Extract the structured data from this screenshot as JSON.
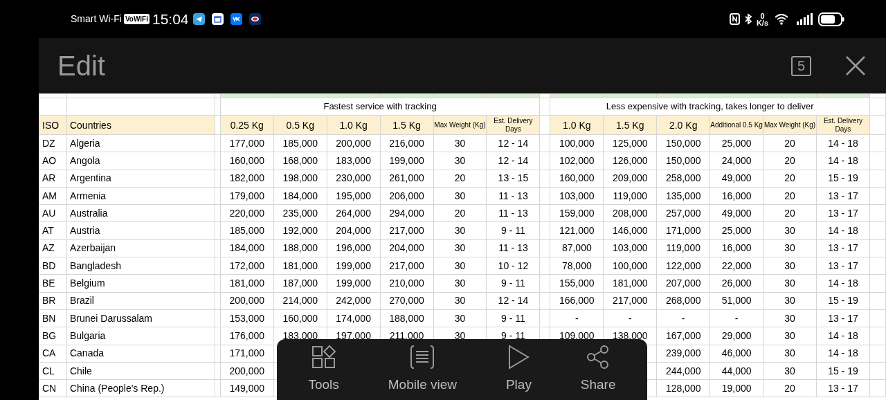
{
  "status_bar": {
    "carrier": "Smart Wi-Fi",
    "wifi_calling": "VoWiFi",
    "time": "15:04",
    "speed_value": "0",
    "speed_unit": "K/s"
  },
  "header": {
    "title": "Edit",
    "tab_count": "5"
  },
  "table": {
    "groups": [
      {
        "subtitle": "Fastest service with tracking"
      },
      {
        "subtitle": "Less expensive with tracking, takes longer to deliver"
      }
    ],
    "columns": [
      {
        "label": "ISO",
        "kind": "plain"
      },
      {
        "label": "Countries",
        "kind": "plain"
      },
      {
        "label": "0.25 Kg",
        "kind": "plain"
      },
      {
        "label": "0.5 Kg",
        "kind": "plain"
      },
      {
        "label": "1.0 Kg",
        "kind": "plain"
      },
      {
        "label": "1.5 Kg",
        "kind": "plain"
      },
      {
        "label": "Max Weight (Kg)",
        "kind": "note"
      },
      {
        "label": "Est. Delivery Days",
        "kind": "note"
      },
      {
        "label": "1.0 Kg",
        "kind": "plain"
      },
      {
        "label": "1.5 Kg",
        "kind": "plain"
      },
      {
        "label": "2.0 Kg",
        "kind": "plain"
      },
      {
        "label": "Additional 0.5 Kg",
        "kind": "note"
      },
      {
        "label": "Max Weight (Kg)",
        "kind": "note"
      },
      {
        "label": "Est. Delivery Days",
        "kind": "note"
      }
    ],
    "rows": [
      {
        "cells": [
          "DZ",
          "Algeria",
          "177,000",
          "185,000",
          "200,000",
          "216,000",
          "30",
          "12 - 14",
          "100,000",
          "125,000",
          "150,000",
          "25,000",
          "20",
          "14 - 18"
        ]
      },
      {
        "cells": [
          "AO",
          "Angola",
          "160,000",
          "168,000",
          "183,000",
          "199,000",
          "30",
          "12 - 14",
          "102,000",
          "126,000",
          "150,000",
          "24,000",
          "20",
          "14 - 18"
        ]
      },
      {
        "cells": [
          "AR",
          "Argentina",
          "182,000",
          "198,000",
          "230,000",
          "261,000",
          "20",
          "13 - 15",
          "160,000",
          "209,000",
          "258,000",
          "49,000",
          "20",
          "15 - 19"
        ]
      },
      {
        "cells": [
          "AM",
          "Armenia",
          "179,000",
          "184,000",
          "195,000",
          "206,000",
          "30",
          "11 - 13",
          "103,000",
          "119,000",
          "135,000",
          "16,000",
          "20",
          "13 - 17"
        ]
      },
      {
        "cells": [
          "AU",
          "Australia",
          "220,000",
          "235,000",
          "264,000",
          "294,000",
          "20",
          "11 - 13",
          "159,000",
          "208,000",
          "257,000",
          "49,000",
          "20",
          "13 - 17"
        ]
      },
      {
        "cells": [
          "AT",
          "Austria",
          "185,000",
          "192,000",
          "204,000",
          "217,000",
          "30",
          "9 - 11",
          "121,000",
          "146,000",
          "171,000",
          "25,000",
          "30",
          "14 - 18"
        ]
      },
      {
        "cells": [
          "AZ",
          "Azerbaijan",
          "184,000",
          "188,000",
          "196,000",
          "204,000",
          "30",
          "11 - 13",
          "87,000",
          "103,000",
          "119,000",
          "16,000",
          "30",
          "13 - 17"
        ]
      },
      {
        "cells": [
          "BD",
          "Bangladesh",
          "172,000",
          "181,000",
          "199,000",
          "217,000",
          "30",
          "10 - 12",
          "78,000",
          "100,000",
          "122,000",
          "22,000",
          "30",
          "13 - 17"
        ]
      },
      {
        "cells": [
          "BE",
          "Belgium",
          "181,000",
          "187,000",
          "199,000",
          "210,000",
          "30",
          "9 - 11",
          "155,000",
          "181,000",
          "207,000",
          "26,000",
          "30",
          "14 - 18"
        ]
      },
      {
        "cells": [
          "BR",
          "Brazil",
          "200,000",
          "214,000",
          "242,000",
          "270,000",
          "30",
          "12 - 14",
          "166,000",
          "217,000",
          "268,000",
          "51,000",
          "30",
          "15 - 19"
        ]
      },
      {
        "cells": [
          "BN",
          "Brunei Darussalam",
          "153,000",
          "160,000",
          "174,000",
          "188,000",
          "30",
          "9 - 11",
          "-",
          "-",
          "-",
          "-",
          "30",
          "13 - 17"
        ]
      },
      {
        "cells": [
          "BG",
          "Bulgaria",
          "176,000",
          "183,000",
          "197,000",
          "211,000",
          "30",
          "9 - 11",
          "109,000",
          "138,000",
          "167,000",
          "29,000",
          "30",
          "14 - 18"
        ]
      },
      {
        "cells": [
          "CA",
          "Canada",
          "171,000",
          null,
          null,
          null,
          null,
          null,
          null,
          null,
          "239,000",
          "46,000",
          "30",
          "14 - 18"
        ]
      },
      {
        "cells": [
          "CL",
          "Chile",
          "200,000",
          null,
          null,
          null,
          null,
          null,
          null,
          null,
          "244,000",
          "44,000",
          "30",
          "15 - 19"
        ]
      },
      {
        "cells": [
          "CN",
          "China (People's Rep.)",
          "149,000",
          null,
          null,
          null,
          null,
          null,
          null,
          null,
          "128,000",
          "19,000",
          "20",
          "13 - 17"
        ]
      }
    ]
  },
  "toolbar": [
    {
      "label": "Tools",
      "kind": "tools"
    },
    {
      "label": "Mobile view",
      "kind": "mobile"
    },
    {
      "label": "Play",
      "kind": "play"
    },
    {
      "label": "Share",
      "kind": "share"
    }
  ]
}
